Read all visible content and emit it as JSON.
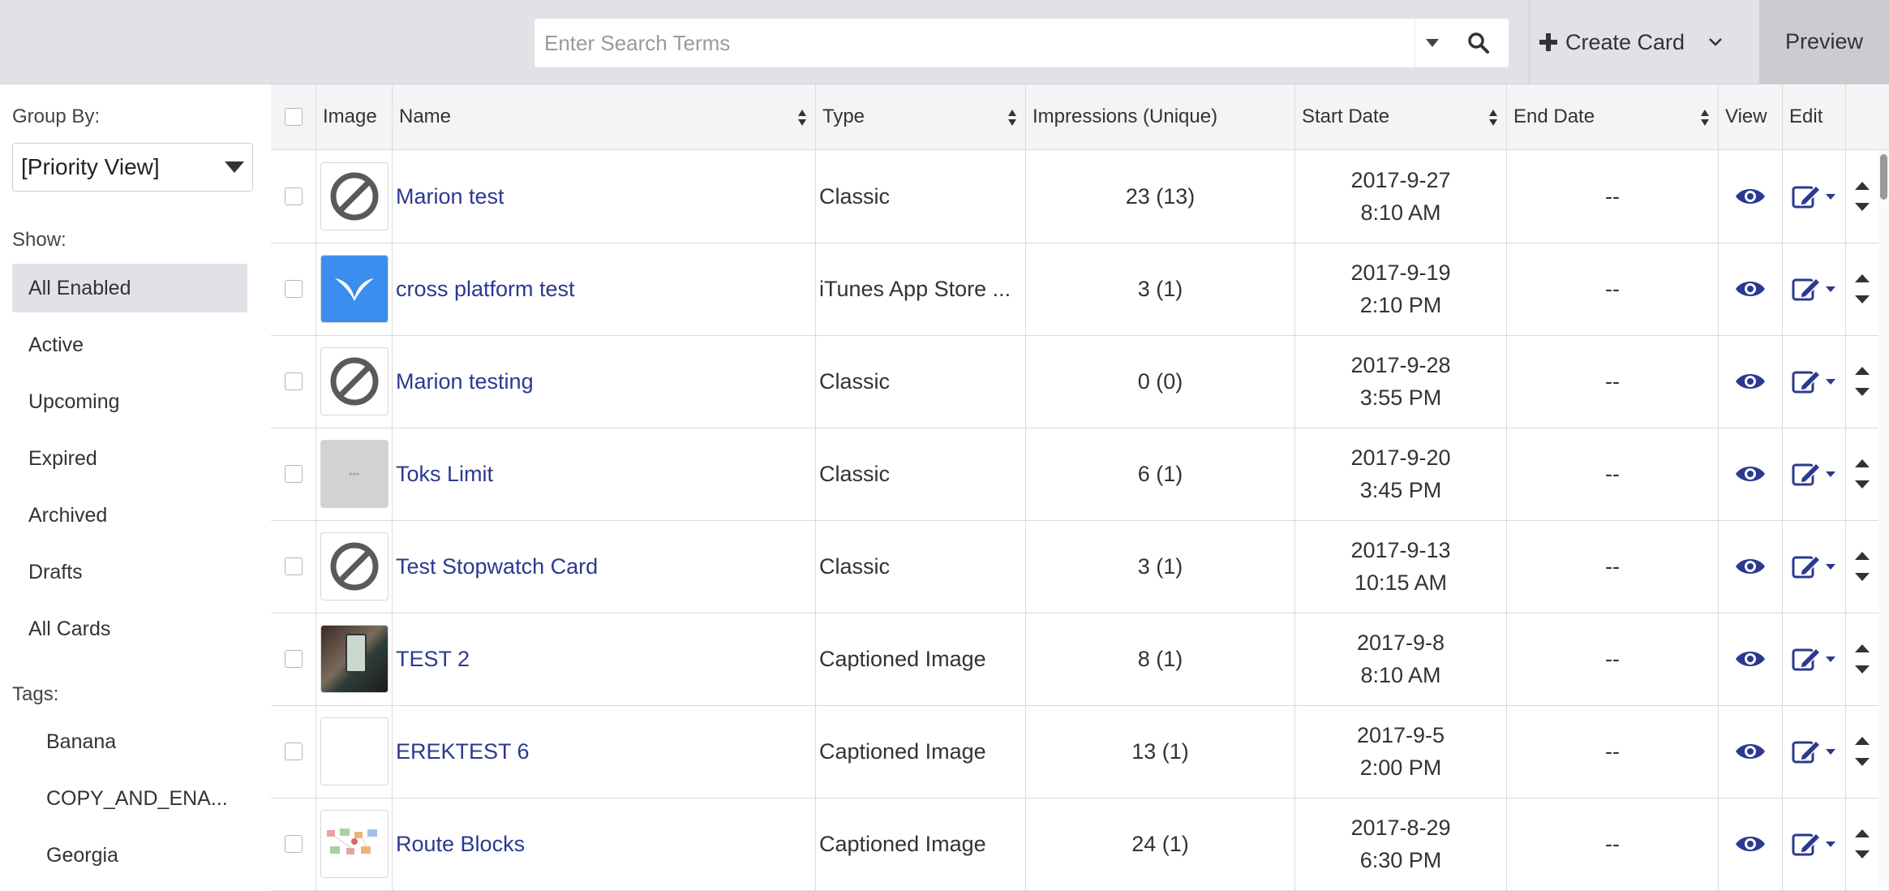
{
  "search": {
    "placeholder": "Enter Search Terms"
  },
  "toolbar": {
    "create_card": "Create Card",
    "preview": "Preview"
  },
  "sidebar": {
    "group_by_label": "Group By:",
    "group_by_value": "[Priority View]",
    "show_label": "Show:",
    "show_items": [
      "All Enabled",
      "Active",
      "Upcoming",
      "Expired",
      "Archived",
      "Drafts",
      "All Cards"
    ],
    "tags_label": "Tags:",
    "tags": [
      "Banana",
      "COPY_AND_ENA...",
      "Georgia"
    ]
  },
  "table": {
    "headers": {
      "image": "Image",
      "name": "Name",
      "type": "Type",
      "impressions": "Impressions (Unique)",
      "start_date": "Start Date",
      "end_date": "End Date",
      "view": "View",
      "edit": "Edit"
    },
    "rows": [
      {
        "thumb": "blocked-icon",
        "name": "Marion test",
        "type": "Classic",
        "impressions": "23 (13)",
        "start_date": "2017-9-27",
        "start_time": "8:10 AM",
        "end_date": "--"
      },
      {
        "thumb": "app-logo",
        "name": "cross platform test",
        "type": "iTunes App Store ...",
        "impressions": "3 (1)",
        "start_date": "2017-9-19",
        "start_time": "2:10 PM",
        "end_date": "--"
      },
      {
        "thumb": "blocked-icon",
        "name": "Marion testing",
        "type": "Classic",
        "impressions": "0 (0)",
        "start_date": "2017-9-28",
        "start_time": "3:55 PM",
        "end_date": "--"
      },
      {
        "thumb": "placeholder-image",
        "name": "Toks Limit",
        "type": "Classic",
        "impressions": "6 (1)",
        "start_date": "2017-9-20",
        "start_time": "3:45 PM",
        "end_date": "--"
      },
      {
        "thumb": "blocked-icon",
        "name": "Test Stopwatch Card",
        "type": "Classic",
        "impressions": "3 (1)",
        "start_date": "2017-9-13",
        "start_time": "10:15 AM",
        "end_date": "--"
      },
      {
        "thumb": "photo",
        "name": "TEST 2",
        "type": "Captioned Image",
        "impressions": "8 (1)",
        "start_date": "2017-9-8",
        "start_time": "8:10 AM",
        "end_date": "--"
      },
      {
        "thumb": "blank",
        "name": "EREKTEST 6",
        "type": "Captioned Image",
        "impressions": "13 (1)",
        "start_date": "2017-9-5",
        "start_time": "2:00 PM",
        "end_date": "--"
      },
      {
        "thumb": "diagram",
        "name": "Route Blocks",
        "type": "Captioned Image",
        "impressions": "24 (1)",
        "start_date": "2017-8-29",
        "start_time": "6:30 PM",
        "end_date": "--"
      }
    ]
  },
  "colors": {
    "link": "#2b3990",
    "topbar": "#e1e2e7",
    "app_logo_bg": "#3b8ef0"
  }
}
